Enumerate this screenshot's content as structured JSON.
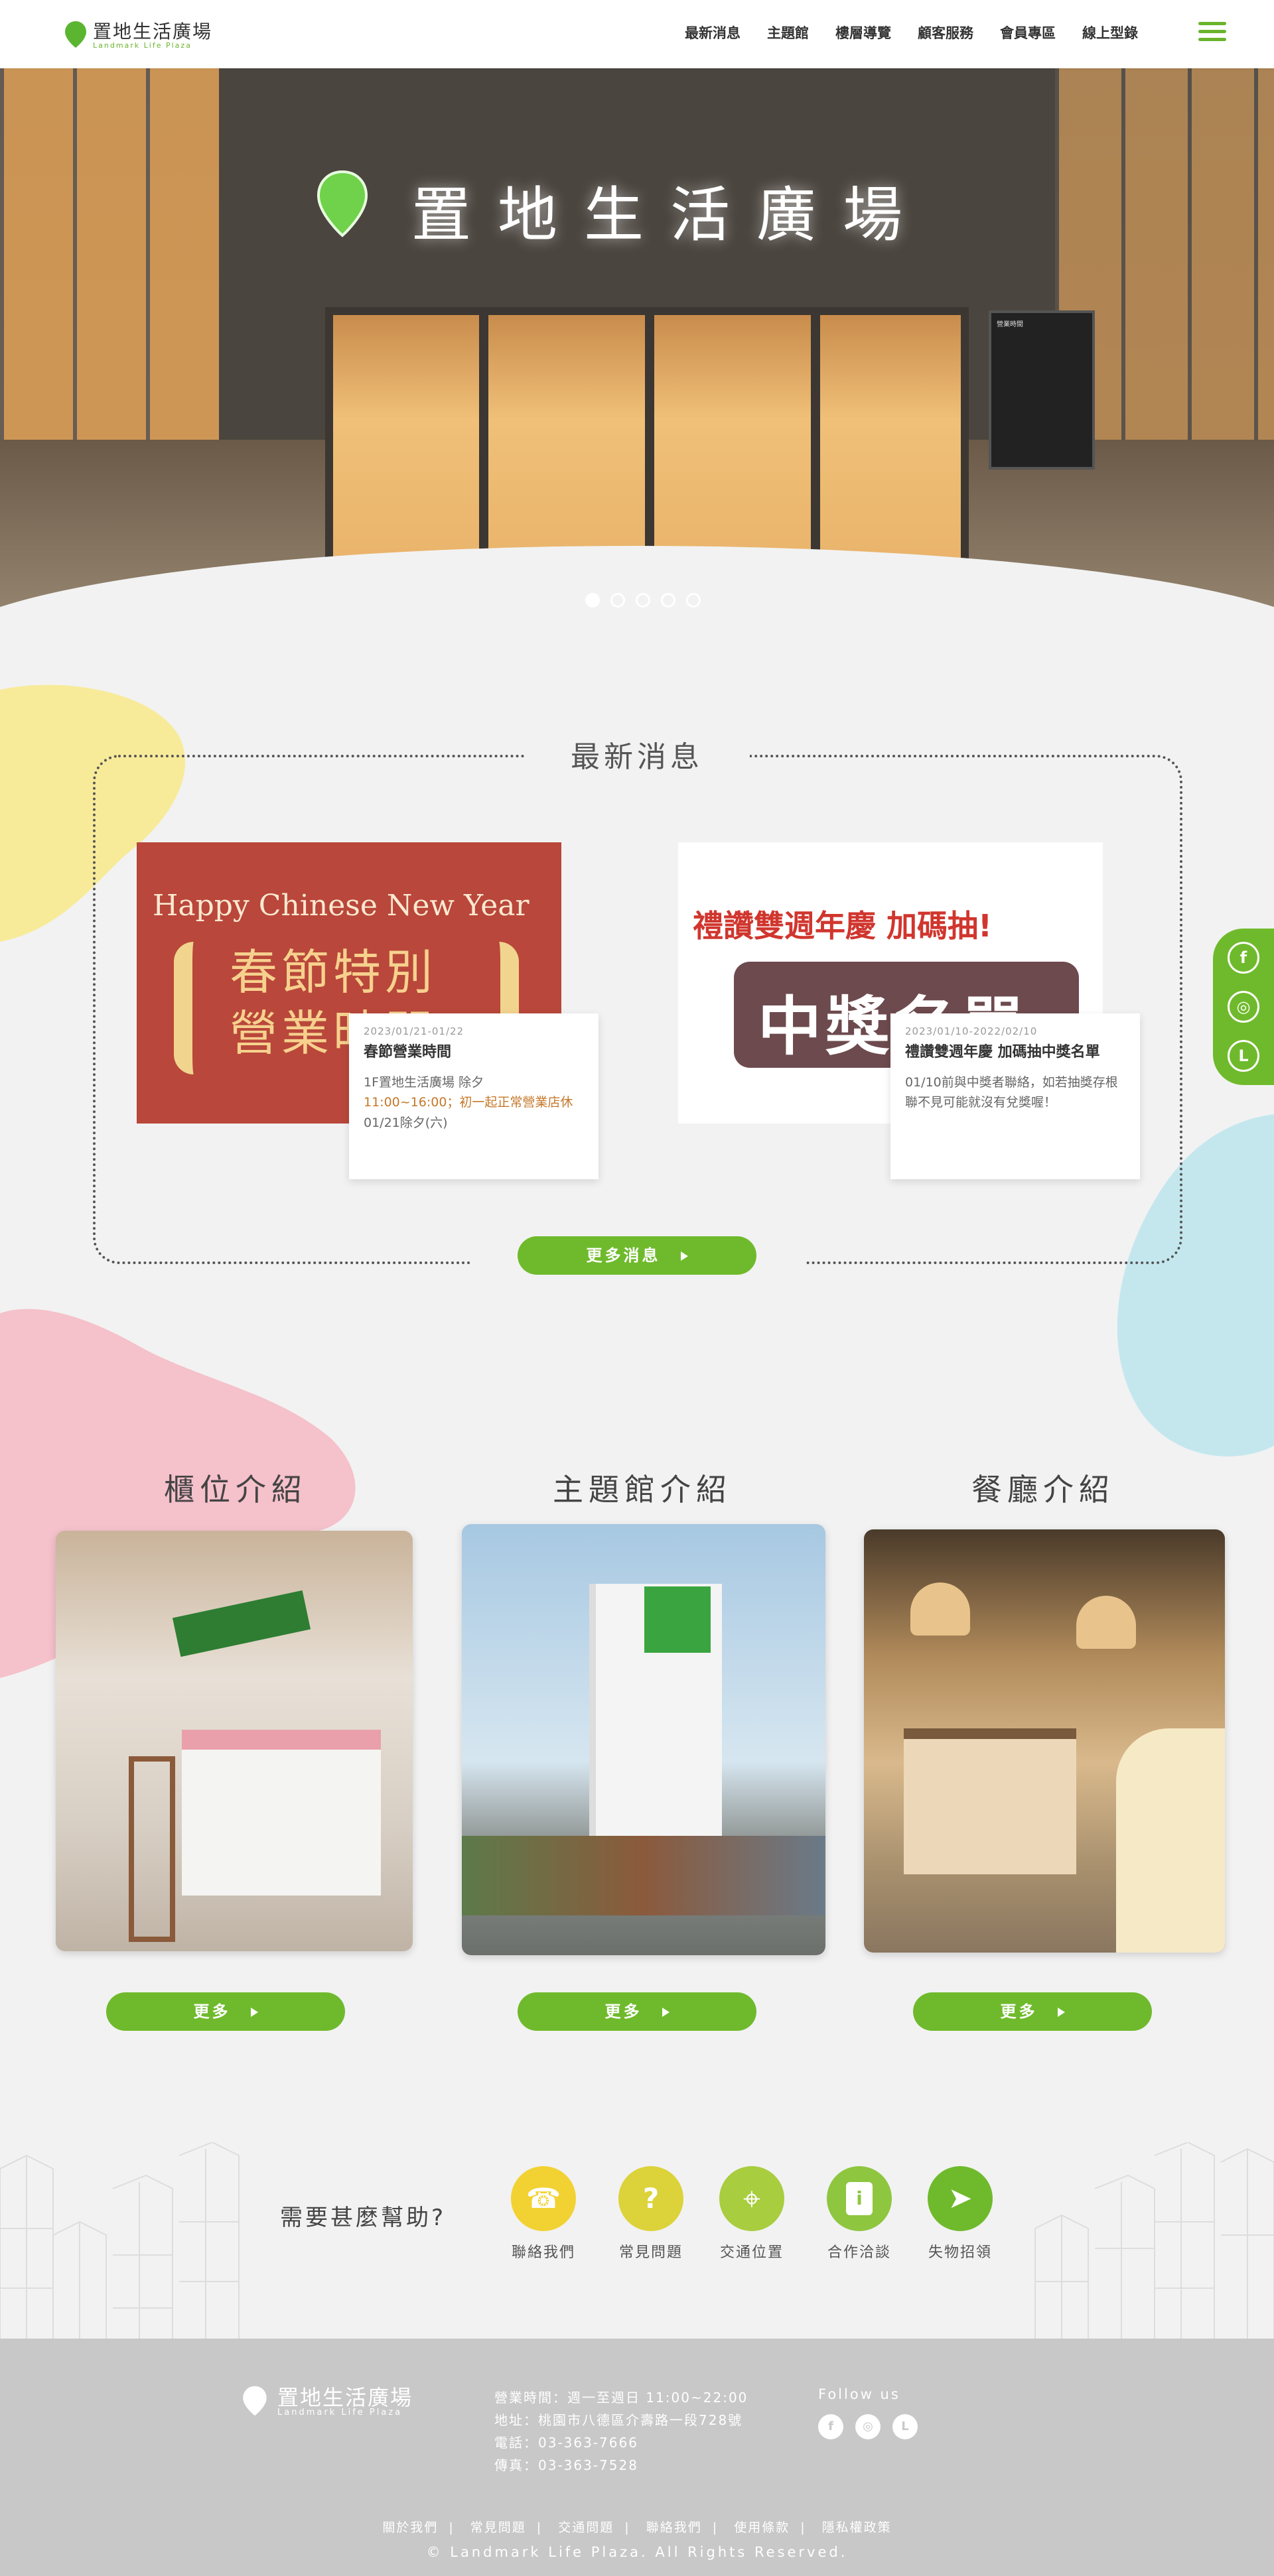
{
  "header": {
    "logo_name": "置地生活廣場",
    "logo_sub": "Landmark Life Plaza",
    "nav": [
      "最新消息",
      "主題館",
      "樓層導覽",
      "顧客服務",
      "會員專區",
      "線上型錄"
    ]
  },
  "hero": {
    "sign_text": "置地生活廣場",
    "slide_count": 5,
    "active_slide": 1,
    "board_title": "營業時間"
  },
  "news": {
    "title": "最新消息",
    "items": [
      {
        "image_heading": "Happy Chinese New Year",
        "image_text": "春節特別營業時間",
        "date": "2023/01/21-01/22",
        "title": "春節營業時間",
        "desc": [
          "1F置地生活廣場 除夕",
          "11:00~16:00；初一起正常營業店休",
          " 01/21除夕(六)"
        ]
      },
      {
        "image_heading": "禮讚雙週年慶 加碼抽!",
        "image_text": "中獎名單",
        "date": "2023/01/10-2022/02/10",
        "title": "禮讚雙週年慶 加碼抽中獎名單",
        "desc": [
          "01/10前與中獎者聯絡，如若抽獎存根聯不見可能就沒有兌獎喔！"
        ]
      }
    ],
    "more_label": "更多消息"
  },
  "social": {
    "items": [
      "facebook-icon",
      "instagram-icon",
      "line-icon"
    ],
    "glyphs": [
      "f",
      "◎",
      "L"
    ]
  },
  "categories": [
    {
      "title": "櫃位介紹",
      "more": "更多"
    },
    {
      "title": "主題館介紹",
      "more": "更多"
    },
    {
      "title": "餐廳介紹",
      "more": "更多"
    }
  ],
  "help": {
    "label": "需要甚麼幫助?",
    "items": [
      {
        "label": "聯絡我們",
        "color": "#f2d232",
        "glyph": "☎"
      },
      {
        "label": "常見問題",
        "color": "#dcd23a",
        "glyph": "?"
      },
      {
        "label": "交通位置",
        "color": "#a8cd3e",
        "glyph": "⌖"
      },
      {
        "label": "合作洽談",
        "color": "#8ec63f",
        "glyph": "i"
      },
      {
        "label": "失物招領",
        "color": "#6fba2c",
        "glyph": "➤"
      }
    ]
  },
  "footer": {
    "logo_name": "置地生活廣場",
    "logo_sub": "Landmark Life Plaza",
    "hours": "營業時間：週一至週日 11:00~22:00",
    "address": "地址：桃園市八德區介壽路一段728號",
    "phone": "電話：03-363-7666",
    "fax": "傳真：03-363-7528",
    "follow": "Follow us",
    "links": [
      "關於我們",
      "常見問題",
      "交通問題",
      "聯絡我們",
      "使用條款",
      "隱私權政策"
    ],
    "copyright": "© Landmark Life Plaza. All Rights Reserved."
  },
  "colors": {
    "accent": "#6fba2c",
    "yellow_blob": "#f7eb9a",
    "pink_blob": "#f5c1cb",
    "blue_blob": "#c4e7ee"
  }
}
